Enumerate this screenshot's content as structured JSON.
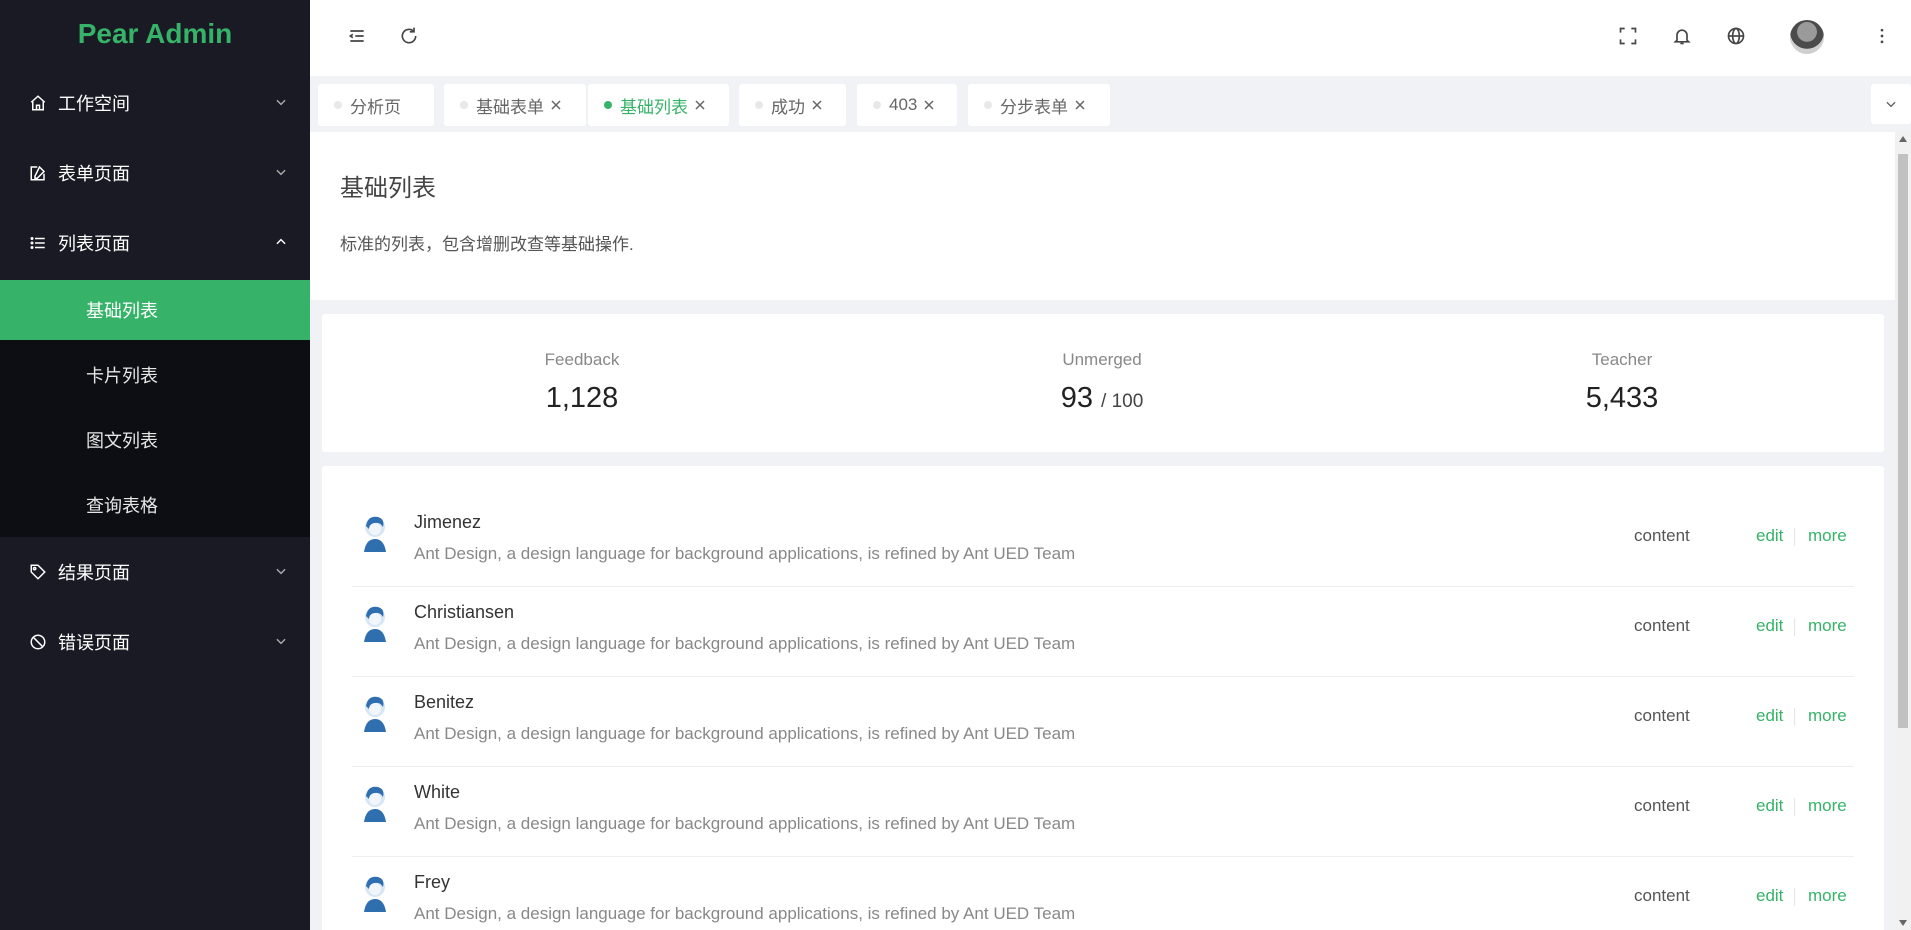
{
  "app": {
    "logo": "Pear Admin"
  },
  "colors": {
    "accent": "#36b368",
    "sidebar_bg": "#191a23",
    "submenu_bg": "#0d0e14"
  },
  "sidebar": {
    "items": [
      {
        "label": "工作空间",
        "icon": "home-icon",
        "expanded": false
      },
      {
        "label": "表单页面",
        "icon": "edit-icon",
        "expanded": false
      },
      {
        "label": "列表页面",
        "icon": "list-icon",
        "expanded": true,
        "children": [
          {
            "label": "基础列表",
            "active": true
          },
          {
            "label": "卡片列表",
            "active": false
          },
          {
            "label": "图文列表",
            "active": false
          },
          {
            "label": "查询表格",
            "active": false
          }
        ]
      },
      {
        "label": "结果页面",
        "icon": "tag-icon",
        "expanded": false
      },
      {
        "label": "错误页面",
        "icon": "ban-icon",
        "expanded": false
      }
    ]
  },
  "header": {
    "icons": [
      "menu-fold-icon",
      "refresh-icon",
      "fullscreen-icon",
      "bell-icon",
      "globe-icon",
      "avatar",
      "more-vertical-icon"
    ]
  },
  "tabs": [
    {
      "label": "分析页",
      "closable": false,
      "active": false
    },
    {
      "label": "基础表单",
      "closable": true,
      "active": false
    },
    {
      "label": "基础列表",
      "closable": true,
      "active": true
    },
    {
      "label": "成功",
      "closable": true,
      "active": false
    },
    {
      "label": "403",
      "closable": true,
      "active": false
    },
    {
      "label": "分步表单",
      "closable": true,
      "active": false
    }
  ],
  "page": {
    "title": "基础列表",
    "description": "标准的列表，包含增删改查等基础操作."
  },
  "stats": [
    {
      "label": "Feedback",
      "value": "1,128",
      "suffix": ""
    },
    {
      "label": "Unmerged",
      "value": "93",
      "suffix": "/ 100"
    },
    {
      "label": "Teacher",
      "value": "5,433",
      "suffix": ""
    }
  ],
  "list": {
    "rows": [
      {
        "name": "Jimenez",
        "description": "Ant Design, a design language for background applications, is refined by Ant UED Team",
        "content": "content",
        "edit": "edit",
        "more": "more"
      },
      {
        "name": "Christiansen",
        "description": "Ant Design, a design language for background applications, is refined by Ant UED Team",
        "content": "content",
        "edit": "edit",
        "more": "more"
      },
      {
        "name": "Benitez",
        "description": "Ant Design, a design language for background applications, is refined by Ant UED Team",
        "content": "content",
        "edit": "edit",
        "more": "more"
      },
      {
        "name": "White",
        "description": "Ant Design, a design language for background applications, is refined by Ant UED Team",
        "content": "content",
        "edit": "edit",
        "more": "more"
      },
      {
        "name": "Frey",
        "description": "Ant Design, a design language for background applications, is refined by Ant UED Team",
        "content": "content",
        "edit": "edit",
        "more": "more"
      }
    ]
  }
}
